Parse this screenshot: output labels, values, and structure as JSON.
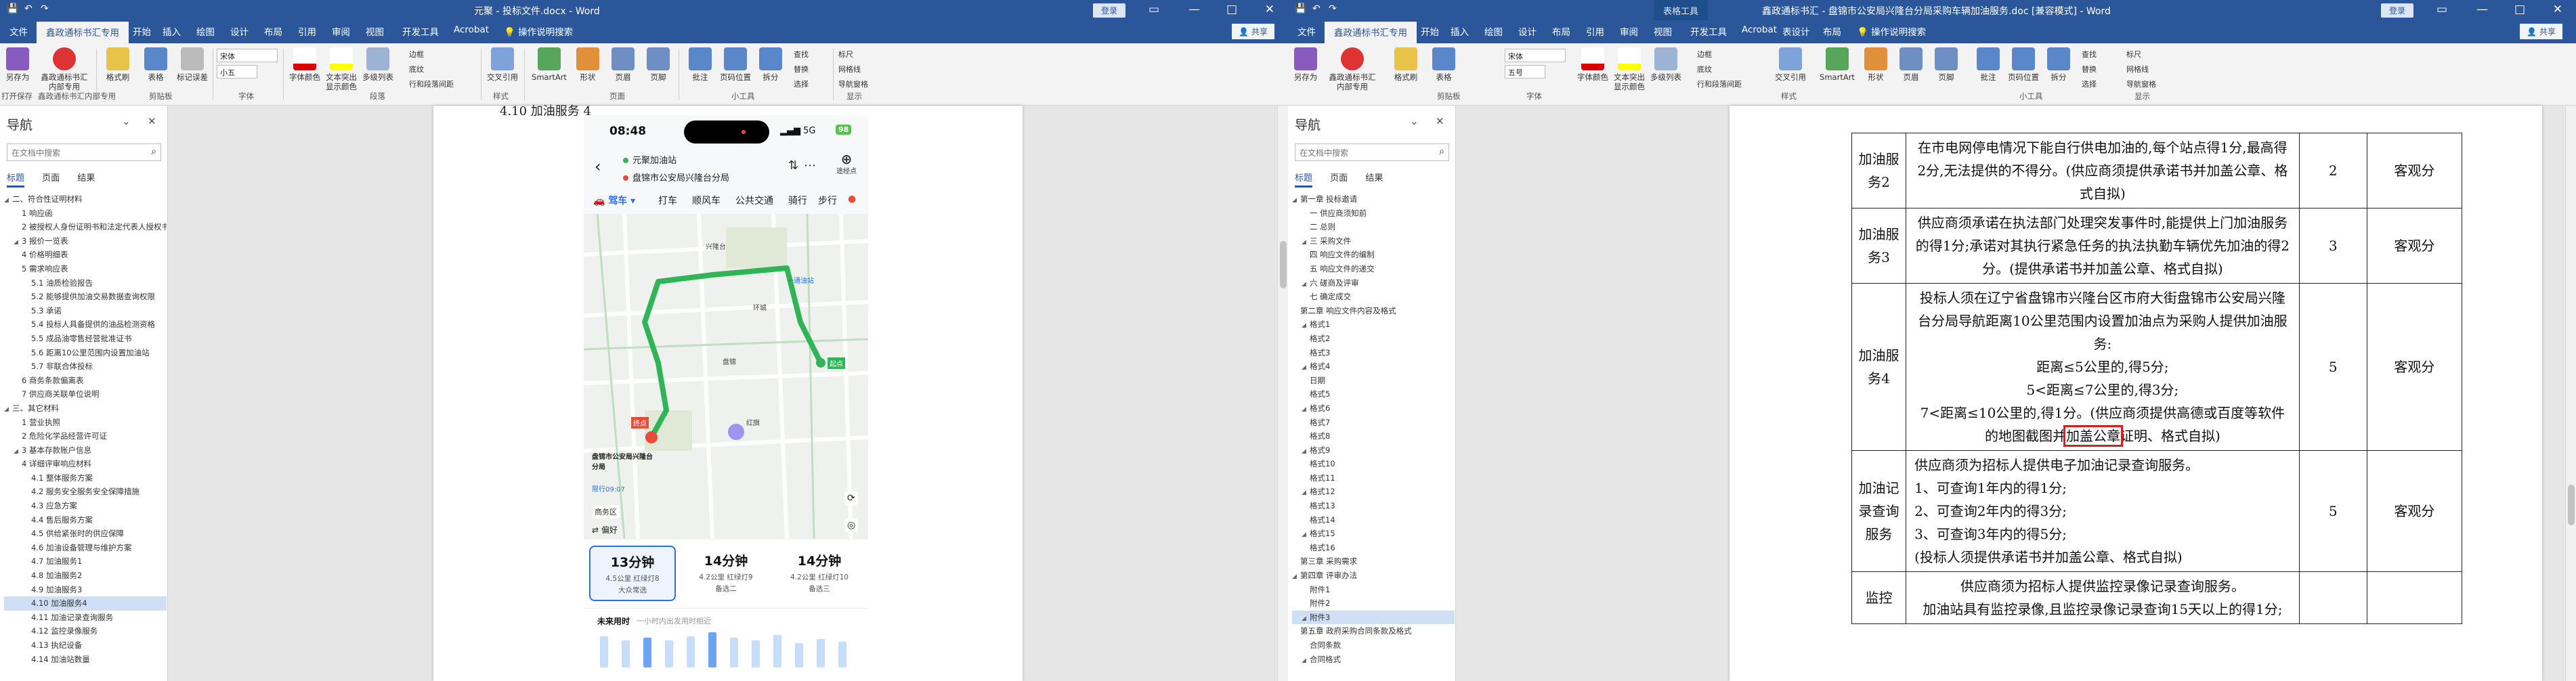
{
  "left": {
    "title": "元聚 - 投标文件.docx - Word",
    "signin": "登录",
    "tabs": [
      "文件",
      "鑫政通标书汇专用",
      "开始",
      "插入",
      "绘图",
      "设计",
      "布局",
      "引用",
      "审阅",
      "视图",
      "开发工具",
      "Acrobat",
      "操作说明搜索"
    ],
    "share": "共享",
    "ribbon": {
      "buttons": [
        "另存为",
        "鑫政通标书汇内部专用",
        "格式刷",
        "表格",
        "标记误差",
        "字体颜色",
        "文本突出显示颜色",
        "多级列表",
        "交叉引用",
        "SmartArt",
        "形状",
        "页眉",
        "页脚",
        "批注",
        "页码位置",
        "拆分"
      ],
      "font_name": "宋体",
      "font_size": "小五",
      "small": [
        "边框",
        "底纹",
        "行和段落间距",
        "查找",
        "替换",
        "选择",
        "标尺",
        "网格线",
        "导航窗格"
      ],
      "groups": [
        "打开保存",
        "鑫政通标书汇内部专用",
        "剪贴板",
        "字体",
        "段落",
        "样式",
        "页面",
        "小工具",
        "显示"
      ]
    },
    "nav": {
      "title": "导航",
      "search_placeholder": "在文档中搜索",
      "tabs": [
        "标题",
        "页面",
        "结果"
      ],
      "items": [
        "二、符合性证明材料",
        "1 响应函",
        "2 被授权人身份证明书和法定代表人授权书",
        "3 报价一览表",
        "4 价格明细表",
        "5 需求响应表",
        "5.1 油质检验报告",
        "5.2 能够提供加油交易数据查询权限",
        "5.3 承诺",
        "5.4 投标人具备提供的油品检测资格",
        "5.5 成品油零售经营批准证书",
        "5.6 距离10公里范围内设置加油站",
        "5.7 非联合体投标",
        "6 商务条款偏离表",
        "7 供应商关联单位说明",
        "三、其它材料",
        "1 营业执照",
        "2 危险化学品经营许可证",
        "3 基本存款账户信息",
        "4 详细评审响应材料",
        "4.1 整体服务方案",
        "4.2 服务安全服务安全保障措施",
        "4.3 应急方案",
        "4.4 售后服务方案",
        "4.5 供给紧张时的供应保障",
        "4.6 加油设备管理与维护方案",
        "4.7 加油服务1",
        "4.8 加油服务2",
        "4.9 加油服务3",
        "4.10 加油服务4",
        "4.11 加油记录查询服务",
        "4.12 监控录像服务",
        "4.13 执纪设备",
        "4.14 加油站数量"
      ],
      "selected_index": 29
    },
    "doc": {
      "caption": "4.10 加油服务 4",
      "phone": {
        "time": "08:48",
        "network": "5G",
        "battery": "98",
        "from": "元聚加油站",
        "to": "盘锦市公安局兴隆台分局",
        "add_stop": "途经点",
        "modes": [
          "驾车",
          "打车",
          "顺风车",
          "公共交通",
          "骑行",
          "步行"
        ],
        "map_labels": [
          "一通油站",
          "兴隆台",
          "盘锦",
          "环城",
          "起点",
          "终点",
          "盘锦市公安局兴隆台分局",
          "限行09:07",
          "商务区",
          "红旗",
          "路况",
          "偏好"
        ],
        "cards": [
          {
            "time": "13分钟",
            "meta": "4.5公里 红绿灯8",
            "note": "大众常选"
          },
          {
            "time": "14分钟",
            "meta": "4.2公里 红绿灯9",
            "note": "备选二"
          },
          {
            "time": "14分钟",
            "meta": "4.2公里 红绿灯10",
            "note": "备选三"
          }
        ],
        "future_label": "未来用时",
        "future_sub": "一小时内出发用时相近"
      }
    }
  },
  "right": {
    "title": "鑫政通标书汇 - 盘锦市公安局兴隆台分局采购车辆加油服务.doc [兼容模式] - Word",
    "context_tab": "表格工具",
    "signin": "登录",
    "tabs": [
      "文件",
      "鑫政通标书汇专用",
      "开始",
      "插入",
      "绘图",
      "设计",
      "布局",
      "引用",
      "审阅",
      "视图",
      "开发工具",
      "Acrobat",
      "表设计",
      "布局",
      "操作说明搜索"
    ],
    "share": "共享",
    "ribbon": {
      "font_name": "宋体",
      "font_size": "五号"
    },
    "nav": {
      "title": "导航",
      "search_placeholder": "在文档中搜索",
      "tabs": [
        "标题",
        "页面",
        "结果"
      ],
      "items": [
        "第一章 投标邀请",
        "一 供应商须知前",
        "二 总则",
        "三 采购文件",
        "四 响应文件的编制",
        "五 响应文件的递交",
        "六 磋商及评审",
        "七 确定成交",
        "第二章 响应文件内容及格式",
        "格式1",
        "格式2",
        "格式3",
        "格式4",
        "日期",
        "格式5",
        "格式6",
        "格式7",
        "格式8",
        "格式9",
        "格式10",
        "格式11",
        "格式12",
        "格式13",
        "格式14",
        "格式15",
        "格式16",
        "第三章 采购需求",
        "第四章 评审办法",
        "附件1",
        "附件2",
        "附件3",
        "第五章 政府采购合同条款及格式",
        "合同条款",
        "合同格式"
      ],
      "selected_index": 30
    },
    "table": [
      {
        "name": "加油服务2",
        "content": "在市电网停电情况下能自行供电加油的,每个站点得1分,最高得2分,无法提供的不得分。(供应商须提供承诺书并加盖公章、格式自拟)",
        "score": "2",
        "type": "客观分"
      },
      {
        "name": "加油服务3",
        "content": "供应商须承诺在执法部门处理突发事件时,能提供上门加油服务的得1分;承诺对其执行紧急任务的执法执勤车辆优先加油的得2分。(提供承诺书并加盖公章、格式自拟)",
        "score": "3",
        "type": "客观分"
      },
      {
        "name": "加油服务4",
        "content_lines": [
          "投标人须在辽宁省盘锦市兴隆台区市府大街盘锦市公安局兴隆台分局导航距离10公里范围内设置加油点为采购人提供加油服务:",
          "距离≤5公里的,得5分;",
          "5<距离≤7公里的,得3分;",
          "7<距离≤10公里的,得1分。(供应商须提供高德或百度等软件的地图截图并"
        ],
        "highlight": "加盖公章",
        "tail": "证明、格式自拟)",
        "score": "5",
        "type": "客观分"
      },
      {
        "name": "加油记录查询服务",
        "content_lines": [
          "供应商须为招标人提供电子加油记录查询服务。",
          "1、可查询1年内的得1分;",
          "2、可查询2年内的得3分;",
          "3、可查询3年内的得5分;",
          "(投标人须提供承诺书并加盖公章、格式自拟)"
        ],
        "score": "5",
        "type": "客观分"
      },
      {
        "name": "监控",
        "content_lines": [
          "供应商须为招标人提供监控录像记录查询服务。",
          "加油站具有监控录像,且监控录像记录查询15天以上的得1分;"
        ],
        "score": "",
        "type": ""
      }
    ]
  },
  "colors": {
    "word_blue": "#2b579a",
    "ribbon_bg": "#f3f3f3",
    "highlight_red": "#d21f1f",
    "route_green": "#2fb457",
    "map_blue": "#2b6ff0"
  }
}
